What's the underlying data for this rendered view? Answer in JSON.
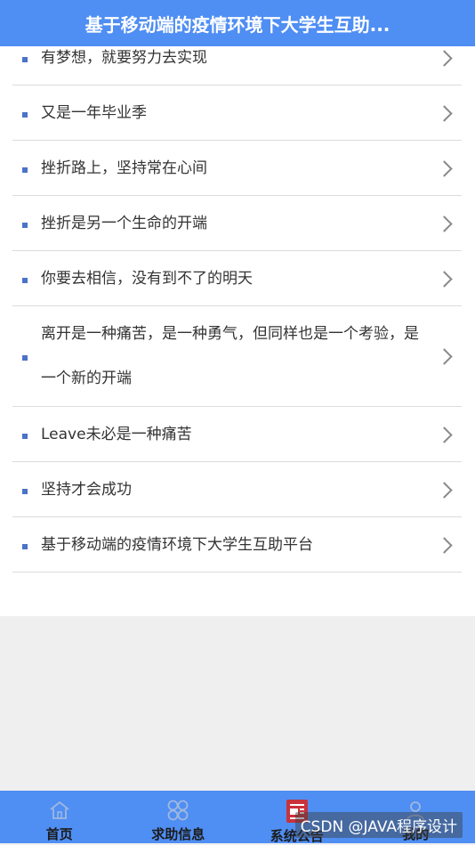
{
  "header": {
    "title": "基于移动端的疫情环境下大学生互助..."
  },
  "list": {
    "items": [
      {
        "text": "有梦想，就要努力去实现"
      },
      {
        "text": "又是一年毕业季"
      },
      {
        "text": "挫折路上，坚持常在心间"
      },
      {
        "text": "挫折是另一个生命的开端"
      },
      {
        "text": "你要去相信，没有到不了的明天"
      },
      {
        "text": "离开是一种痛苦，是一种勇气，但同样也是一个考验，是一个新的开端"
      },
      {
        "text": "Leave未必是一种痛苦"
      },
      {
        "text": "坚持才会成功"
      },
      {
        "text": "基于移动端的疫情环境下大学生互助平台"
      }
    ]
  },
  "tabbar": {
    "tabs": [
      {
        "label": "首页",
        "icon": "home-icon"
      },
      {
        "label": "求助信息",
        "icon": "grid-clover-icon"
      },
      {
        "label": "系统公告",
        "icon": "notice-icon"
      },
      {
        "label": "我的",
        "icon": "user-icon"
      }
    ]
  },
  "watermark": {
    "text": "CSDN @JAVA程序设计"
  },
  "colors": {
    "header_bg": "#4f8ef3",
    "bullet": "#4b73c7",
    "notice_icon_red": "#c8323c"
  }
}
